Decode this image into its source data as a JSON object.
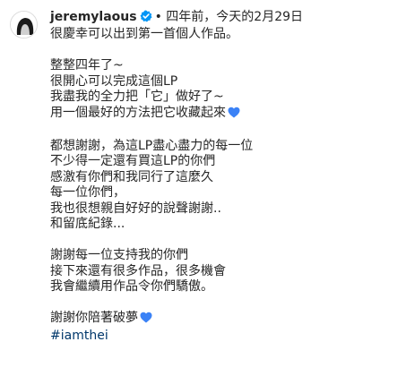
{
  "post": {
    "username": "jeremylaous",
    "verified_icon": "verified-badge-icon",
    "separator": "•",
    "time_ago": "四年前",
    "comment_suffix": "，今天的2月29日",
    "caption": {
      "line1": "很慶幸可以出到第一首個人作品。",
      "para1": [
        "整整四年了~",
        "很開心可以完成這個LP",
        "我盡我的全力把「它」做好了~",
        "用一個最好的方法把它收藏起來"
      ],
      "para2": [
        "都想謝謝，為這LP盡心盡力的每一位",
        "不少得一定還有買這LP的你們",
        "感激有你們和我同行了這麼久",
        "每一位你們，",
        "我也很想親自好好的說聲謝謝..",
        "和留底紀錄..."
      ],
      "para3": [
        "謝謝每一位支持我的你們",
        "接下來還有很多作品，很多機會",
        "我會繼續用作品令你們驕傲。"
      ],
      "closing": "謝謝你陪著破夢",
      "hashtag": "#iamthei"
    },
    "heart_color": "#3b82f6",
    "verified_color": "#0095f6"
  }
}
